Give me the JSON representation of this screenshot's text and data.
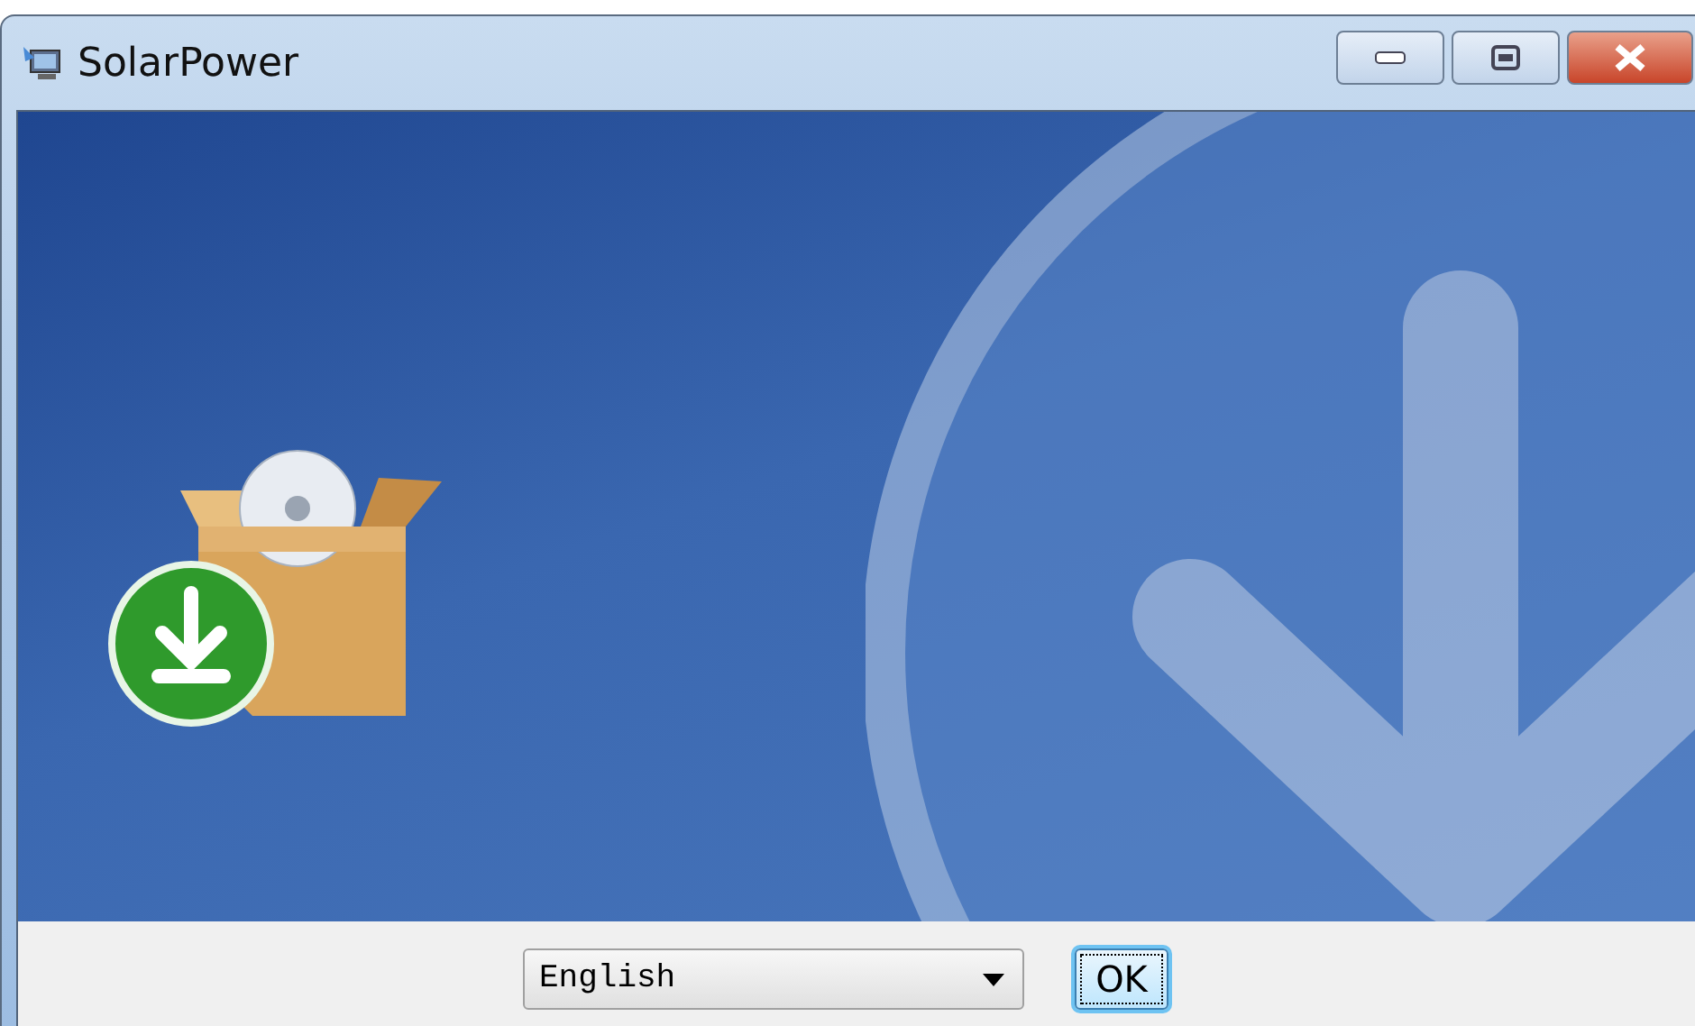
{
  "window": {
    "title": "SolarPower"
  },
  "language_select": {
    "value": "English"
  },
  "buttons": [
    {
      "label": "OK",
      "focused": true
    }
  ]
}
